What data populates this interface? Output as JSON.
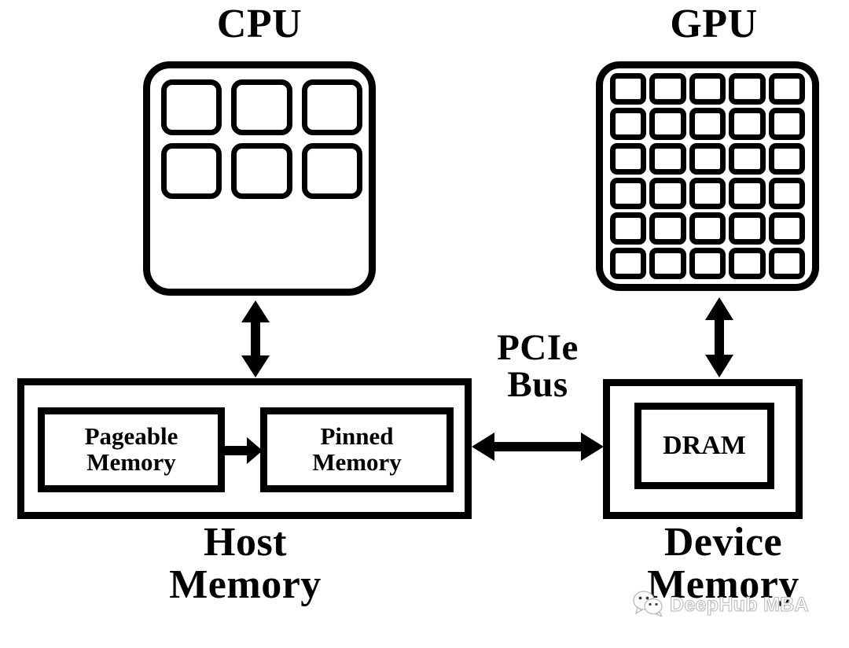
{
  "diagram": {
    "title_cpu": "CPU",
    "title_gpu": "GPU",
    "host_label": "Host\nMemory",
    "device_label": "Device\nMemory",
    "bus_label": "PCIe\nBus",
    "pageable_label": "Pageable\nMemory",
    "pinned_label": "Pinned\nMemory",
    "dram_label": "DRAM",
    "stroke_color": "#000000",
    "background_color": "#ffffff",
    "cpu_core_count": 6,
    "cpu_grid": {
      "cols": 3,
      "rows": 2
    },
    "gpu_core_count": 30,
    "gpu_grid": {
      "cols": 5,
      "rows": 6
    }
  },
  "watermark": {
    "text": "DeepHub MBA",
    "icon": "wechat-icon",
    "color": "#ffffff"
  }
}
